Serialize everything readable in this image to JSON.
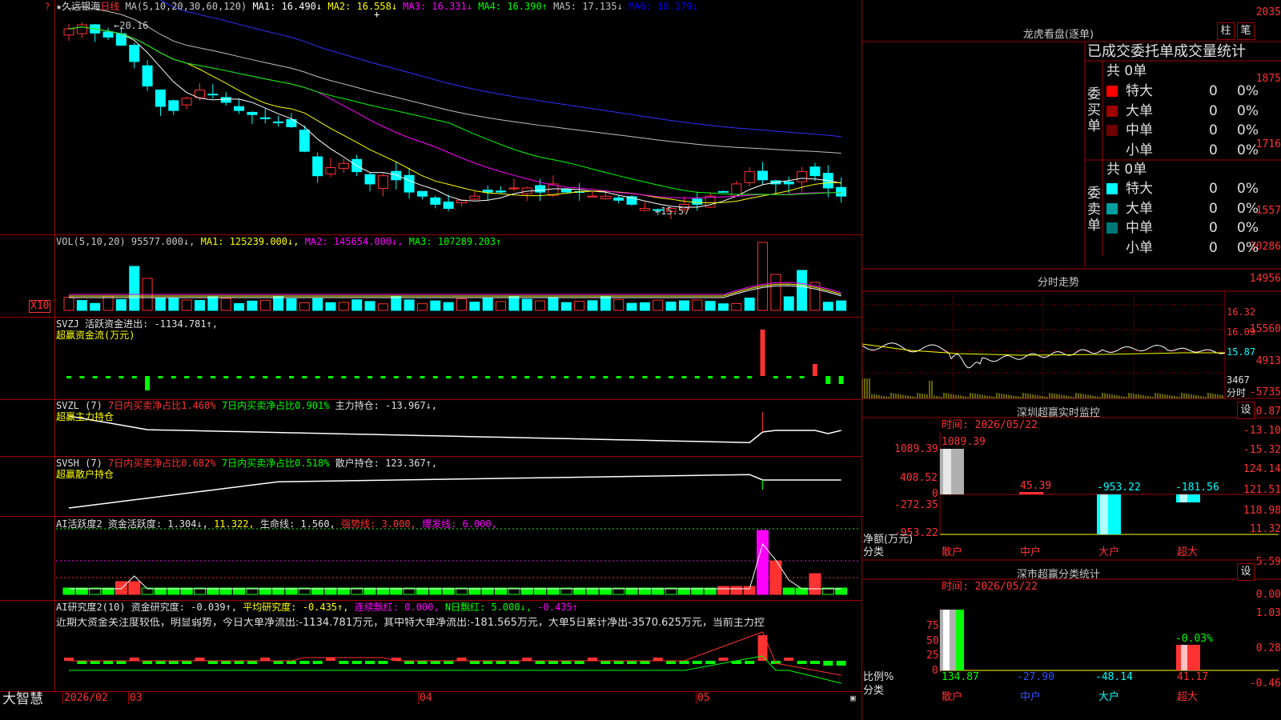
{
  "stock": {
    "title": "★久远银海",
    "period": "日线",
    "ma_header": "MA(5,10,20,30,60,120)",
    "ma_values": [
      {
        "label": "MA1: 16.490↓",
        "color": "#ffffff"
      },
      {
        "label": "MA2: 16.558↓",
        "color": "#ffff00"
      },
      {
        "label": "MA3: 16.331↓",
        "color": "#ff00ff"
      },
      {
        "label": "MA4: 16.390↑",
        "color": "#00ff00"
      },
      {
        "label": "MA5: 17.135↓",
        "color": "#c0c0c0"
      },
      {
        "label": "MA6: 18.179↓",
        "color": "#0000ff"
      }
    ],
    "high_marker": "←20.16",
    "low_marker": "←15.57"
  },
  "price_axis": [
    "2035",
    "1875",
    "1716",
    "1557"
  ],
  "vol": {
    "header": "VOL(5,10,20) 95577.000↓,",
    "ma1": "MA1: 125239.000↓,",
    "ma2": "MA2: 145654.000↓,",
    "ma3": "MA3: 107289.203↑",
    "axis": [
      "30286",
      "14956"
    ],
    "unit": "X10"
  },
  "svzj": {
    "header": "SVZJ  活跃资金进出: -1134.781↑,",
    "sub": "超赢资金流(万元)",
    "axis": [
      "15560",
      "4913",
      "-5735"
    ]
  },
  "svzl": {
    "header": "SVZL (7)",
    "a": "7日内买卖净占比1.468%",
    "b": "7日内买卖净占比0.901%",
    "c": "主力持仓: -13.967↓,",
    "sub": "超赢主力持仓",
    "axis": [
      "-10.87",
      "-13.10",
      "-15.32"
    ]
  },
  "svsh": {
    "header": "SVSH (7)",
    "a": "7日内买卖净占比0.682%",
    "b": "7日内买卖净占比0.518%",
    "c": "散户持仓: 123.367↑,",
    "sub": "超赢散户持仓",
    "axis": [
      "124.14",
      "121.51",
      "118.98"
    ]
  },
  "ai_active": {
    "header": "AI活跃度2 资金活跃度: 1.304↓,",
    "v2": "11.322,",
    "life": "生命线: 1.560,",
    "strong": "强势线: 3.000,",
    "burst": "爆发线: 6.000,",
    "axis": [
      "11.32",
      "5.59",
      "0.00"
    ]
  },
  "ai_research": {
    "header": "AI研究度2(10) 资金研究度: -0.039↑,",
    "avg": "平均研究度: -0.435↑,",
    "cont": "连续飘红: 0.000,",
    "n": "N日飘红: 5.000↓,",
    "last": "-0.435↑",
    "desc": "近期大资金关注度较低，明显弱势，今日大单净流出:-1134.781万元，其中特大单净流出:-181.565万元，大单5日累计净出-3570.625万元，当前主力控",
    "axis": [
      "1.03",
      "0.28",
      "-0.46"
    ]
  },
  "date_axis": [
    "2026/02",
    "03",
    "04",
    "05"
  ],
  "brand": "大智慧",
  "right": {
    "title": "龙虎看盘(逐单)",
    "btn_bar": "柱",
    "btn_pen": "笔",
    "stat_title": "已成交委托单成交量统计",
    "buy_label": "委买单",
    "sell_label": "委卖单",
    "buy_total": "共 0单",
    "sell_total": "共 0单",
    "buy_rows": [
      {
        "name": "特大",
        "count": "0",
        "pct": "0%",
        "color": "#ff0000"
      },
      {
        "name": "大单",
        "count": "0",
        "pct": "0%",
        "color": "#a00000"
      },
      {
        "name": "中单",
        "count": "0",
        "pct": "0%",
        "color": "#6e0000"
      },
      {
        "name": "小单",
        "count": "0",
        "pct": "0%",
        "color": "#000000"
      }
    ],
    "sell_rows": [
      {
        "name": "特大",
        "count": "0",
        "pct": "0%",
        "color": "#00ffff"
      },
      {
        "name": "大单",
        "count": "0",
        "pct": "0%",
        "color": "#00a0a0"
      },
      {
        "name": "中单",
        "count": "0",
        "pct": "0%",
        "color": "#007878"
      },
      {
        "name": "小单",
        "count": "0",
        "pct": "0%",
        "color": "#000000"
      }
    ],
    "intraday_title": "分时走势",
    "intraday_axis": [
      "16.32",
      "16.09",
      "15.87",
      "3467"
    ],
    "intraday_unit": "分时",
    "monitor_title": "深圳超赢实时监控",
    "monitor_settings": "设",
    "monitor_time": "时间: 2026/05/22",
    "monitor_axis": [
      "1089.39",
      "408.52",
      "0",
      "-272.35",
      "-953.22"
    ],
    "monitor_values": [
      "1089.39",
      "45.39",
      "-953.22",
      "-181.56"
    ],
    "monitor_ylabel": "净额(万元)",
    "monitor_xlabel": "分类",
    "categories": [
      "散户",
      "中户",
      "大户",
      "超大"
    ],
    "class_title": "深市超赢分类统计",
    "class_settings": "设",
    "class_time": "时间: 2026/05/22",
    "class_axis": [
      "75",
      "50",
      "25",
      "0"
    ],
    "class_top_label": "-0.03%",
    "class_values": [
      "134.87",
      "-27.90",
      "-48.14",
      "41.17"
    ],
    "class_ylabel": "比例%",
    "class_xlabel": "分类"
  }
}
